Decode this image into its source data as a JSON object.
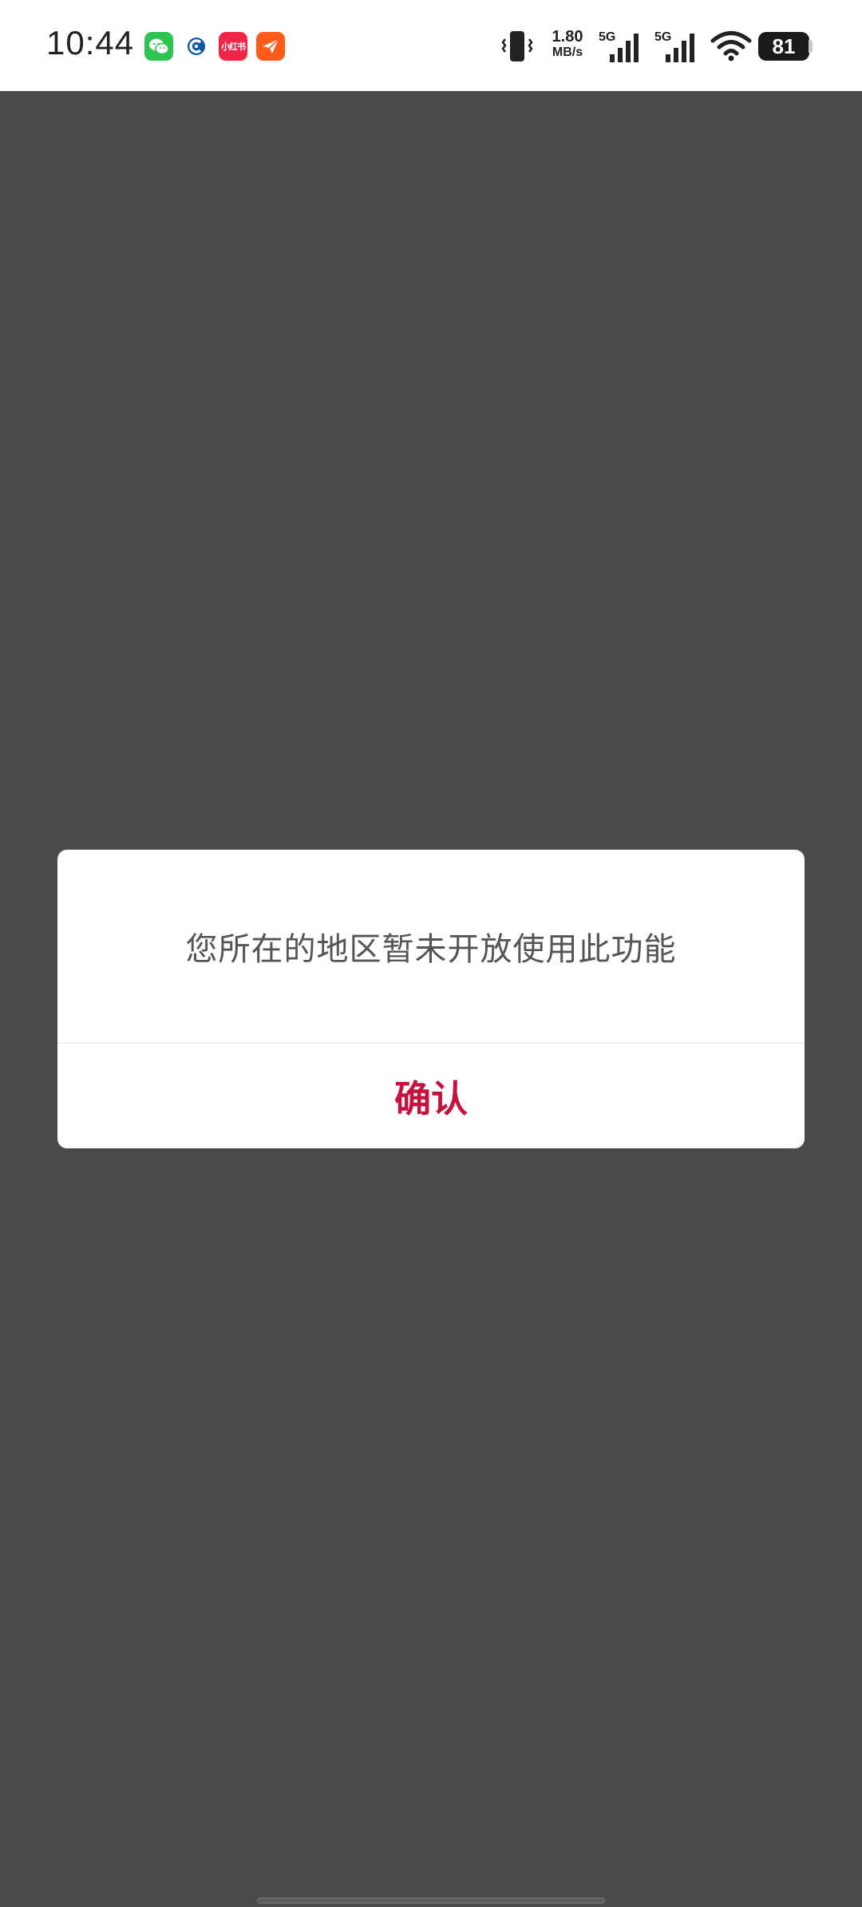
{
  "status_bar": {
    "time": "10:44",
    "notification_icons": [
      "wechat-icon",
      "cmb-bank-icon",
      "xiaohongshu-icon",
      "paper-plane-icon"
    ],
    "xhs_label": "小红书",
    "net_speed_value": "1.80",
    "net_speed_unit": "MB/s",
    "signal1_label": "5G",
    "signal2_label": "5G",
    "battery_level": "81"
  },
  "dialog": {
    "message": "您所在的地区暂未开放使用此功能",
    "confirm_label": "确认",
    "confirm_color": "#c8103e"
  },
  "colors": {
    "overlay": "#4a4a4a",
    "status_bar_bg": "#ffffff"
  }
}
